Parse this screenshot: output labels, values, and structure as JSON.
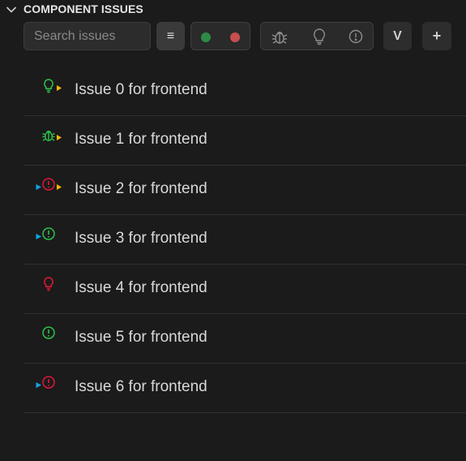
{
  "header": {
    "title": "COMPONENT ISSUES"
  },
  "toolbar": {
    "search_placeholder": "Search issues",
    "menu_glyph": "≡",
    "v_label": "V",
    "plus_label": "+",
    "status_filters": [
      {
        "name": "open",
        "color": "#2e8b46"
      },
      {
        "name": "closed",
        "color": "#c94e4e"
      }
    ],
    "type_filters": [
      "bug-icon",
      "lightbulb-icon",
      "alert-circle-icon"
    ]
  },
  "colors": {
    "green": "#2cc24a",
    "red": "#e0173a",
    "yellow": "#f5b800",
    "blue": "#12a3e3"
  },
  "issues": [
    {
      "label": "Issue 0 for frontend",
      "type": "lightbulb",
      "color": "green",
      "left_flag": false,
      "right_flag": true
    },
    {
      "label": "Issue 1 for frontend",
      "type": "bug",
      "color": "green",
      "left_flag": false,
      "right_flag": true
    },
    {
      "label": "Issue 2 for frontend",
      "type": "alert",
      "color": "red",
      "left_flag": true,
      "right_flag": true
    },
    {
      "label": "Issue 3 for frontend",
      "type": "alert",
      "color": "green",
      "left_flag": true,
      "right_flag": false
    },
    {
      "label": "Issue 4 for frontend",
      "type": "lightbulb",
      "color": "red",
      "left_flag": false,
      "right_flag": false
    },
    {
      "label": "Issue 5 for frontend",
      "type": "alert",
      "color": "green",
      "left_flag": false,
      "right_flag": false
    },
    {
      "label": "Issue 6 for frontend",
      "type": "alert",
      "color": "red",
      "left_flag": true,
      "right_flag": false
    }
  ]
}
